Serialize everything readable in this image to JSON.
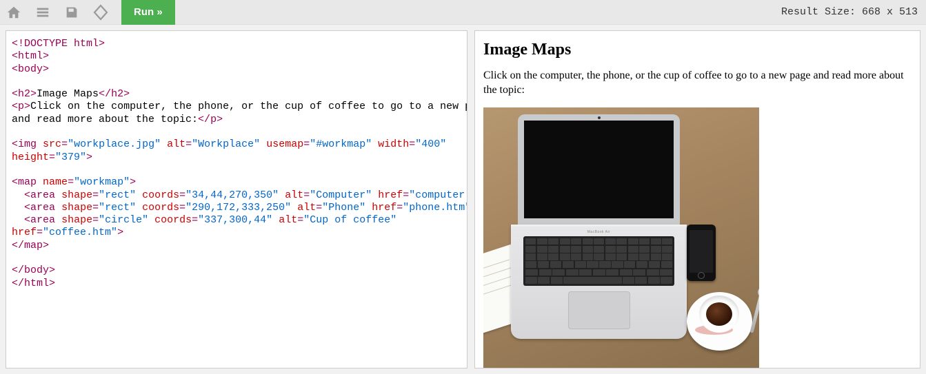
{
  "toolbar": {
    "run_label": "Run »"
  },
  "result_size_label": "Result Size: 668 x 513",
  "code": {
    "doctype": "<!DOCTYPE html>",
    "html_open": "html",
    "body_open": "body",
    "h2_tag": "h2",
    "h2_text": "Image Maps",
    "p_tag": "p",
    "p_text_1": "Click on the computer, the phone, or the cup of coffee to go to a new page ",
    "p_text_2": "and read more about the topic:",
    "img_tag": "img",
    "img_src_attr": "src",
    "img_src_val": "\"workplace.jpg\"",
    "img_alt_attr": "alt",
    "img_alt_val": "\"Workplace\"",
    "img_usemap_attr": "usemap",
    "img_usemap_val": "\"#workmap\"",
    "img_width_attr": "width",
    "img_width_val": "\"400\"",
    "img_height_attr": "height",
    "img_height_val": "\"379\"",
    "map_tag": "map",
    "map_name_attr": "name",
    "map_name_val": "\"workmap\"",
    "area_tag": "area",
    "shape_attr": "shape",
    "coords_attr": "coords",
    "alt_attr": "alt",
    "href_attr": "href",
    "area1_shape": "\"rect\"",
    "area1_coords": "\"34,44,270,350\"",
    "area1_alt": "\"Computer\"",
    "area1_href": "\"computer.htm\"",
    "area2_shape": "\"rect\"",
    "area2_coords": "\"290,172,333,250\"",
    "area2_alt": "\"Phone\"",
    "area2_href": "\"phone.htm\"",
    "area3_shape": "\"circle\"",
    "area3_coords": "\"337,300,44\"",
    "area3_alt": "\"Cup of coffee\"",
    "area3_href": "\"coffee.htm\"",
    "body_close": "body",
    "html_close": "html"
  },
  "result": {
    "heading": "Image Maps",
    "paragraph": "Click on the computer, the phone, or the cup of coffee to go to a new page and read more about the topic:",
    "brand": "MacBook Air"
  }
}
